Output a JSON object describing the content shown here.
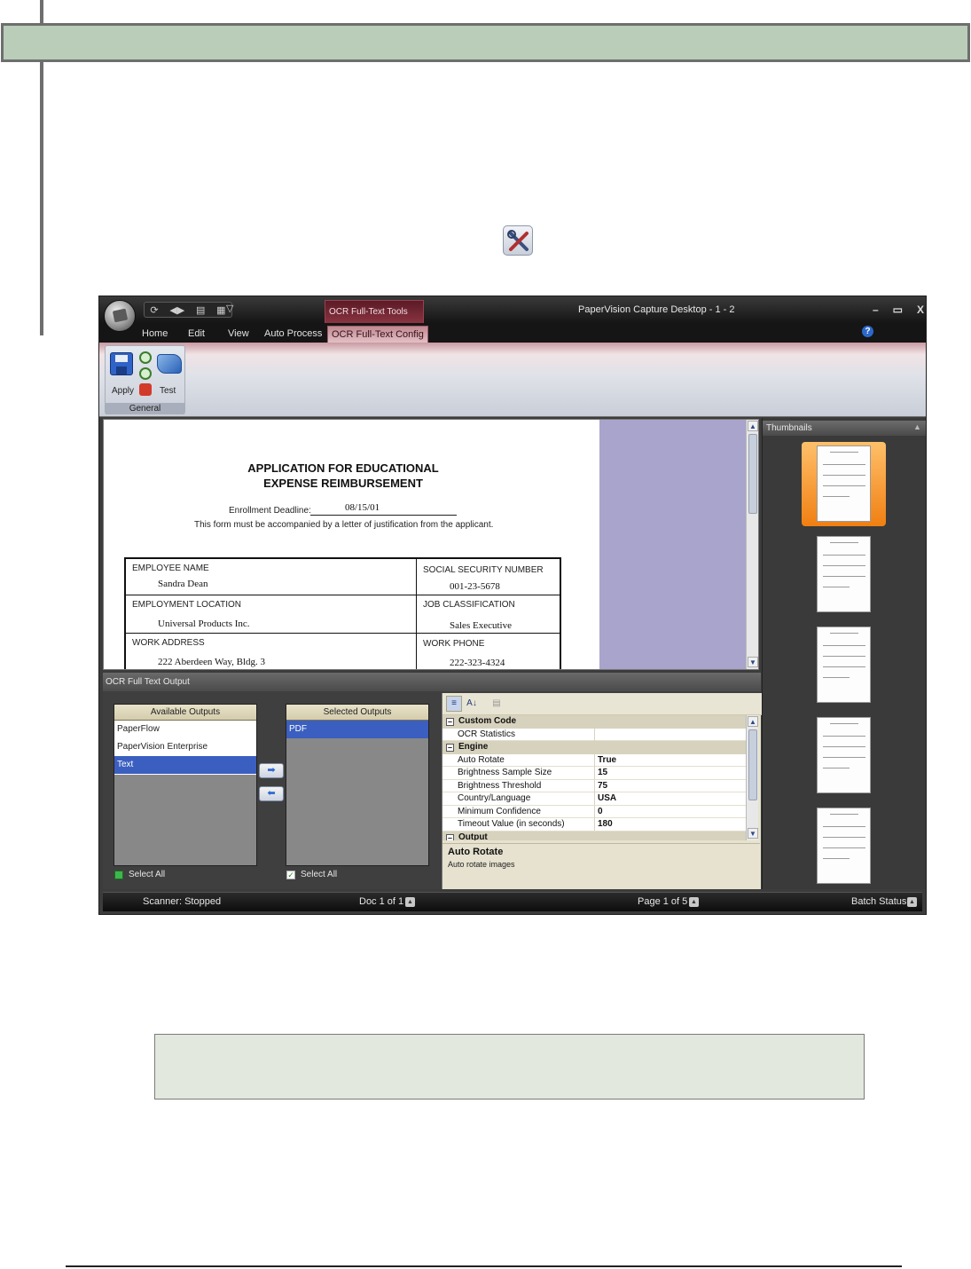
{
  "app": {
    "title": "PaperVision Capture Desktop - 1 - 2",
    "contextual_tab_group": "OCR Full-Text Tools",
    "menu_tabs": [
      "Home",
      "Edit",
      "View",
      "Auto Process",
      "OCR Full-Text Config"
    ],
    "ribbon": {
      "group_label": "General",
      "apply_label": "Apply",
      "test_label": "Test"
    }
  },
  "document": {
    "title_line1": "APPLICATION FOR EDUCATIONAL",
    "title_line2": "EXPENSE REIMBURSEMENT",
    "deadline_label": "Enrollment Deadline:",
    "deadline_value": "08/15/01",
    "instruction": "This form must be accompanied by a letter of justification from the applicant.",
    "fields": [
      {
        "label": "EMPLOYEE NAME",
        "value": "Sandra Dean"
      },
      {
        "label": "SOCIAL SECURITY NUMBER",
        "value": "001-23-5678"
      },
      {
        "label": "EMPLOYMENT LOCATION",
        "value": "Universal Products Inc."
      },
      {
        "label": "JOB CLASSIFICATION",
        "value": "Sales Executive"
      },
      {
        "label": "WORK ADDRESS",
        "value": "222 Aberdeen Way, Bldg. 3"
      },
      {
        "label": "WORK PHONE",
        "value": "222-323-4324"
      }
    ]
  },
  "thumbnails": {
    "title": "Thumbnails"
  },
  "ocr_output": {
    "title": "OCR Full Text Output",
    "available": {
      "header": "Available Outputs",
      "items": [
        "PaperFlow",
        "PaperVision Enterprise",
        "Text"
      ],
      "selected_item": "Text",
      "select_all": "Select All"
    },
    "selected": {
      "header": "Selected Outputs",
      "items": [
        "PDF"
      ],
      "select_all": "Select All"
    }
  },
  "properties": {
    "categories": [
      {
        "name": "Custom Code",
        "rows": [
          {
            "key": "OCR Statistics",
            "value": ""
          }
        ]
      },
      {
        "name": "Engine",
        "rows": [
          {
            "key": "Auto Rotate",
            "value": "True"
          },
          {
            "key": "Brightness Sample Size",
            "value": "15"
          },
          {
            "key": "Brightness Threshold",
            "value": "75"
          },
          {
            "key": "Country/Language",
            "value": "USA"
          },
          {
            "key": "Minimum Confidence",
            "value": "0"
          },
          {
            "key": "Timeout Value (in seconds)",
            "value": "180"
          }
        ]
      },
      {
        "name": "Output",
        "rows": []
      }
    ],
    "description_title": "Auto Rotate",
    "description_text": "Auto rotate images"
  },
  "statusbar": {
    "scanner": "Scanner: Stopped",
    "doc": "Doc 1 of 1",
    "page": "Page 1 of 5",
    "batch": "Batch Status"
  },
  "colors": {
    "header_bar": "#b9cdb8",
    "selection_blue": "#3b5fc0",
    "thumbnail_selected": "#f08a20",
    "note_box": "#e2e8dd"
  }
}
